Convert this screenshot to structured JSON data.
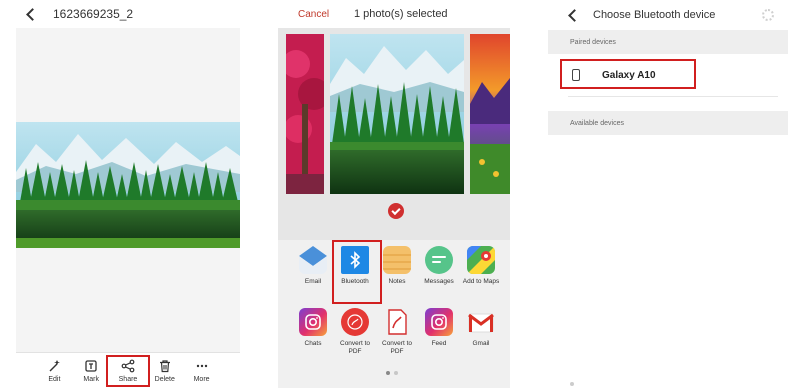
{
  "gallery": {
    "title": "1623669235_2",
    "toolbar": [
      {
        "label": "Edit",
        "icon": "wand-icon"
      },
      {
        "label": "Mark",
        "icon": "mark-icon"
      },
      {
        "label": "Share",
        "icon": "share-icon"
      },
      {
        "label": "Delete",
        "icon": "trash-icon"
      },
      {
        "label": "More",
        "icon": "more-dots-icon"
      }
    ]
  },
  "share_sheet": {
    "cancel_label": "Cancel",
    "selected_text": "1 photo(s) selected",
    "apps": [
      {
        "label": "Email",
        "icon": "email-icon"
      },
      {
        "label": "Bluetooth",
        "icon": "bluetooth-icon"
      },
      {
        "label": "Notes",
        "icon": "notes-icon"
      },
      {
        "label": "Messages",
        "icon": "messages-icon"
      },
      {
        "label": "Add to Maps",
        "icon": "maps-icon"
      },
      {
        "label": "Chats",
        "icon": "instagram-icon"
      },
      {
        "label": "Convert to PDF",
        "icon": "pdf-icon"
      },
      {
        "label": "Convert to PDF",
        "icon": "pdf-doc-icon"
      },
      {
        "label": "Feed",
        "icon": "instagram-icon"
      },
      {
        "label": "Gmail",
        "icon": "gmail-icon"
      }
    ]
  },
  "bluetooth": {
    "title": "Choose Bluetooth device",
    "paired_header": "Paired devices",
    "device_name": "Galaxy A10",
    "available_header": "Available devices"
  },
  "colors": {
    "accent_red": "#d11f1f",
    "cancel_red": "#c0392b",
    "bluetooth_blue": "#1e88e5"
  }
}
